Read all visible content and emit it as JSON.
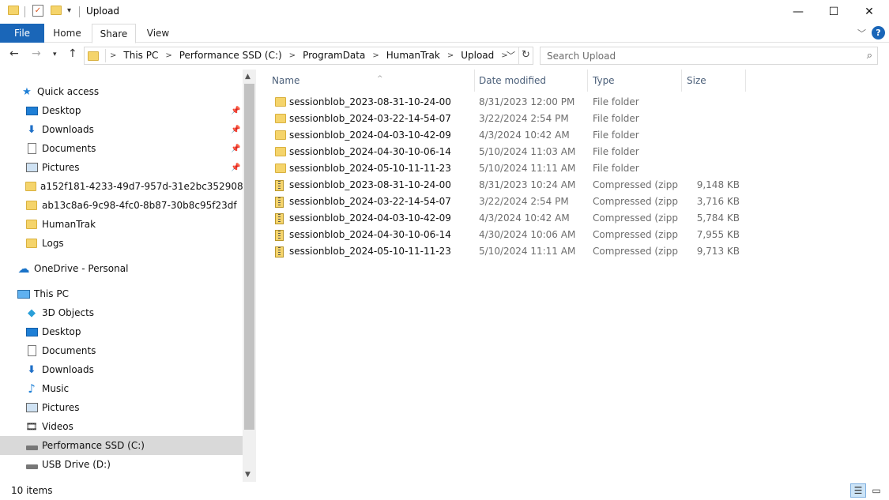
{
  "window": {
    "title": "Upload",
    "minimize_glyph": "—",
    "maximize_glyph": "☐",
    "close_glyph": "✕"
  },
  "ribbon": {
    "tabs": [
      "File",
      "Home",
      "Share",
      "View"
    ],
    "help_label": "?"
  },
  "address": {
    "crumbs": [
      "This PC",
      "Performance SSD (C:)",
      "ProgramData",
      "HumanTrak",
      "Upload"
    ],
    "search_placeholder": "Search Upload"
  },
  "nav": {
    "quick_access": "Quick access",
    "quick_items": [
      "Desktop",
      "Downloads",
      "Documents",
      "Pictures",
      "a152f181-4233-49d7-957d-31e2bc352908",
      "ab13c8a6-9c98-4fc0-8b87-30b8c95f23df",
      "HumanTrak",
      "Logs"
    ],
    "onedrive": "OneDrive - Personal",
    "this_pc": "This PC",
    "pc_items": [
      "3D Objects",
      "Desktop",
      "Documents",
      "Downloads",
      "Music",
      "Pictures",
      "Videos",
      "Performance SSD (C:)",
      "USB Drive (D:)"
    ],
    "selected": "Performance SSD (C:)"
  },
  "columns": {
    "name": "Name",
    "date": "Date modified",
    "type": "Type",
    "size": "Size"
  },
  "files": [
    {
      "name": "sessionblob_2023-08-31-10-24-00",
      "date": "8/31/2023 12:00 PM",
      "type": "File folder",
      "size": "",
      "kind": "folder"
    },
    {
      "name": "sessionblob_2024-03-22-14-54-07",
      "date": "3/22/2024 2:54 PM",
      "type": "File folder",
      "size": "",
      "kind": "folder"
    },
    {
      "name": "sessionblob_2024-04-03-10-42-09",
      "date": "4/3/2024 10:42 AM",
      "type": "File folder",
      "size": "",
      "kind": "folder"
    },
    {
      "name": "sessionblob_2024-04-30-10-06-14",
      "date": "5/10/2024 11:03 AM",
      "type": "File folder",
      "size": "",
      "kind": "folder"
    },
    {
      "name": "sessionblob_2024-05-10-11-11-23",
      "date": "5/10/2024 11:11 AM",
      "type": "File folder",
      "size": "",
      "kind": "folder"
    },
    {
      "name": "sessionblob_2023-08-31-10-24-00",
      "date": "8/31/2023 10:24 AM",
      "type": "Compressed (zipp...",
      "size": "9,148 KB",
      "kind": "zip"
    },
    {
      "name": "sessionblob_2024-03-22-14-54-07",
      "date": "3/22/2024 2:54 PM",
      "type": "Compressed (zipp...",
      "size": "3,716 KB",
      "kind": "zip"
    },
    {
      "name": "sessionblob_2024-04-03-10-42-09",
      "date": "4/3/2024 10:42 AM",
      "type": "Compressed (zipp...",
      "size": "5,784 KB",
      "kind": "zip"
    },
    {
      "name": "sessionblob_2024-04-30-10-06-14",
      "date": "4/30/2024 10:06 AM",
      "type": "Compressed (zipp...",
      "size": "7,955 KB",
      "kind": "zip"
    },
    {
      "name": "sessionblob_2024-05-10-11-11-23",
      "date": "5/10/2024 11:11 AM",
      "type": "Compressed (zipp...",
      "size": "9,713 KB",
      "kind": "zip"
    }
  ],
  "status": {
    "count": "10 items"
  }
}
